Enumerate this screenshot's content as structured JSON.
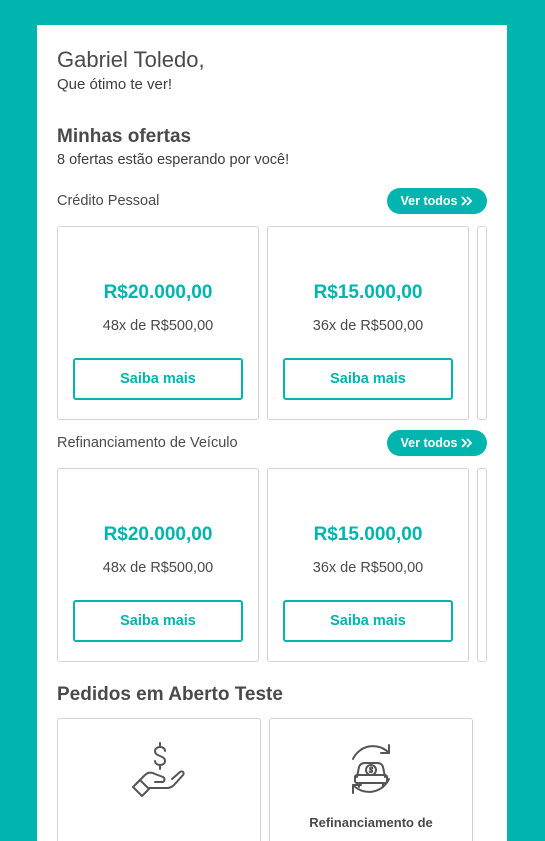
{
  "greeting": {
    "name": "Gabriel Toledo,",
    "subtitle": "Que ótimo te ver!"
  },
  "offers": {
    "title": "Minhas ofertas",
    "subtitle": "8 ofertas estão esperando por você!"
  },
  "groups": [
    {
      "label": "Crédito Pessoal",
      "see_all": "Ver todos",
      "cards": [
        {
          "amount": "R$20.000,00",
          "terms": "48x de R$500,00",
          "button": "Saiba mais"
        },
        {
          "amount": "R$15.000,00",
          "terms": "36x de R$500,00",
          "button": "Saiba mais"
        }
      ]
    },
    {
      "label": "Refinanciamento de Veículo",
      "see_all": "Ver todos",
      "cards": [
        {
          "amount": "R$20.000,00",
          "terms": "48x de R$500,00",
          "button": "Saiba mais"
        },
        {
          "amount": "R$15.000,00",
          "terms": "36x de R$500,00",
          "button": "Saiba mais"
        }
      ]
    }
  ],
  "orders": {
    "title": "Pedidos em Aberto Teste",
    "items": [
      {
        "icon": "hand-dollar-icon",
        "label": ""
      },
      {
        "icon": "car-refinance-icon",
        "label": "Refinanciamento de"
      }
    ]
  },
  "colors": {
    "accent": "#00b5ad",
    "text": "#4a4a4a",
    "border": "#d3d3d3"
  }
}
